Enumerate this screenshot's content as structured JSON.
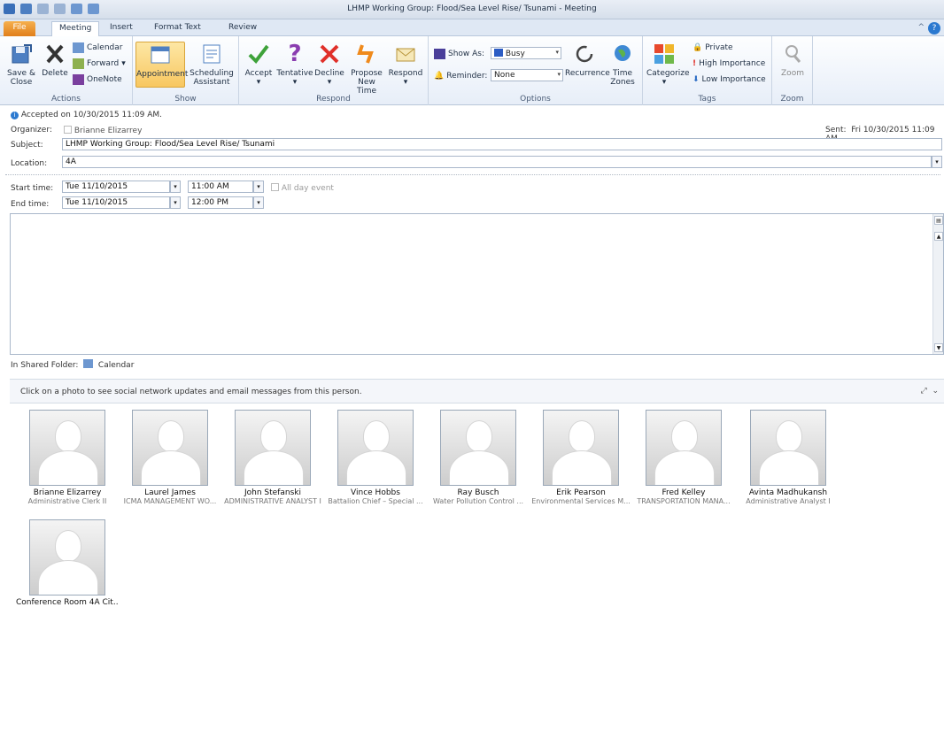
{
  "window": {
    "title": "LHMP Working Group: Flood/Sea Level Rise/ Tsunami  -  Meeting"
  },
  "tabs": [
    {
      "label": "File"
    },
    {
      "label": "Meeting"
    },
    {
      "label": "Insert"
    },
    {
      "label": "Format Text"
    },
    {
      "label": "Review"
    }
  ],
  "ribbon": {
    "actions": {
      "group_label": "Actions",
      "save_close": "Save & Close",
      "delete": "Delete",
      "calendar": "Calendar",
      "forward": "Forward",
      "onenote": "OneNote"
    },
    "show": {
      "group_label": "Show",
      "appointment": "Appointment",
      "scheduling": "Scheduling Assistant"
    },
    "respond": {
      "group_label": "Respond",
      "accept": "Accept",
      "tentative": "Tentative",
      "decline": "Decline",
      "propose": "Propose New Time",
      "respond": "Respond"
    },
    "options": {
      "group_label": "Options",
      "show_as_label": "Show As:",
      "show_as_value": "Busy",
      "reminder_label": "Reminder:",
      "reminder_value": "None",
      "recurrence": "Recurrence",
      "time_zones": "Time Zones"
    },
    "tags": {
      "group_label": "Tags",
      "categorize": "Categorize",
      "private": "Private",
      "high": "High Importance",
      "low": "Low Importance"
    },
    "zoom": {
      "group_label": "Zoom",
      "zoom": "Zoom"
    }
  },
  "info": {
    "accepted": "Accepted on 10/30/2015 11:09 AM."
  },
  "form": {
    "organizer_label": "Organizer:",
    "organizer_value": "Brianne Elizarrey",
    "sent_label": "Sent:",
    "sent_value": "Fri 10/30/2015 11:09 AM",
    "subject_label": "Subject:",
    "subject_value": "LHMP Working Group: Flood/Sea Level Rise/ Tsunami",
    "location_label": "Location:",
    "location_value": "4A",
    "start_label": "Start time:",
    "start_date": "Tue 11/10/2015",
    "start_time": "11:00 AM",
    "all_day": "All day event",
    "end_label": "End time:",
    "end_date": "Tue 11/10/2015",
    "end_time": "12:00 PM"
  },
  "folder": {
    "label": "In Shared Folder:",
    "value": "Calendar"
  },
  "people_pane": {
    "hint": "Click on a photo to see social network updates and email messages from this person.",
    "people": [
      {
        "name": "Brianne Elizarrey",
        "title": "Administrative Clerk II"
      },
      {
        "name": "Laurel James",
        "title": "ICMA MANAGEMENT WO..."
      },
      {
        "name": "John Stefanski",
        "title": "ADMINISTRATIVE ANALYST I"
      },
      {
        "name": "Vince Hobbs",
        "title": "Battalion Chief – Special ..."
      },
      {
        "name": "Ray Busch",
        "title": "Water Pollution Control ..."
      },
      {
        "name": "Erik Pearson",
        "title": "Environmental Services M..."
      },
      {
        "name": "Fred Kelley",
        "title": "TRANSPORTATION MANA..."
      },
      {
        "name": "Avinta Madhukansh",
        "title": "Administrative Analyst I"
      },
      {
        "name": "Conference Room 4A Cit...",
        "title": ""
      }
    ]
  },
  "colors": {
    "accent": "#2b79d0",
    "file_tab": "#e07f1c"
  }
}
